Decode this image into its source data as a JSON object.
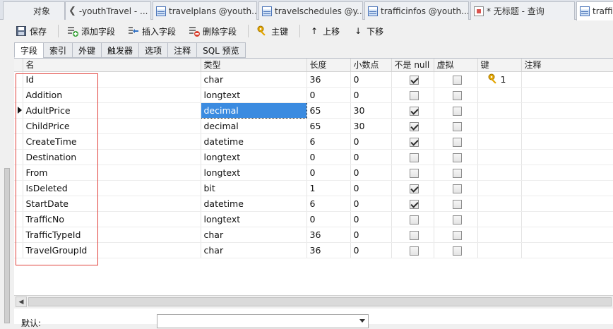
{
  "tabs": [
    {
      "label": "对象",
      "icon": "none"
    },
    {
      "label": "-youthTravel - ...",
      "icon": "back-arrow-icon"
    },
    {
      "label": "travelplans @youth...",
      "icon": "table-icon"
    },
    {
      "label": "travelschedules @y...",
      "icon": "table-icon"
    },
    {
      "label": "trafficinfos @youth...",
      "icon": "table-icon"
    },
    {
      "label": "* 无标题 - 查询",
      "icon": "query-icon"
    },
    {
      "label": "traffic",
      "icon": "table-icon"
    }
  ],
  "toolbar": {
    "save": "保存",
    "add_field": "添加字段",
    "insert_field": "插入字段",
    "delete_field": "删除字段",
    "primary_key": "主键",
    "move_up": "上移",
    "move_down": "下移"
  },
  "subtabs": [
    "字段",
    "索引",
    "外键",
    "触发器",
    "选项",
    "注释",
    "SQL 预览"
  ],
  "columns": {
    "name": "名",
    "type": "类型",
    "length": "长度",
    "decimals": "小数点",
    "not_null": "不是 null",
    "virtual": "虚拟",
    "key": "键",
    "comment": "注释"
  },
  "rows": [
    {
      "name": "Id",
      "type": "char",
      "length": "36",
      "decimals": "0",
      "not_null": true,
      "virtual": false,
      "key": "1"
    },
    {
      "name": "Addition",
      "type": "longtext",
      "length": "0",
      "decimals": "0",
      "not_null": false,
      "virtual": false,
      "key": ""
    },
    {
      "name": "AdultPrice",
      "type": "decimal",
      "length": "65",
      "decimals": "30",
      "not_null": true,
      "virtual": false,
      "key": ""
    },
    {
      "name": "ChildPrice",
      "type": "decimal",
      "length": "65",
      "decimals": "30",
      "not_null": true,
      "virtual": false,
      "key": ""
    },
    {
      "name": "CreateTime",
      "type": "datetime",
      "length": "6",
      "decimals": "0",
      "not_null": true,
      "virtual": false,
      "key": ""
    },
    {
      "name": "Destination",
      "type": "longtext",
      "length": "0",
      "decimals": "0",
      "not_null": false,
      "virtual": false,
      "key": ""
    },
    {
      "name": "From",
      "type": "longtext",
      "length": "0",
      "decimals": "0",
      "not_null": false,
      "virtual": false,
      "key": ""
    },
    {
      "name": "IsDeleted",
      "type": "bit",
      "length": "1",
      "decimals": "0",
      "not_null": true,
      "virtual": false,
      "key": ""
    },
    {
      "name": "StartDate",
      "type": "datetime",
      "length": "6",
      "decimals": "0",
      "not_null": true,
      "virtual": false,
      "key": ""
    },
    {
      "name": "TrafficNo",
      "type": "longtext",
      "length": "0",
      "decimals": "0",
      "not_null": false,
      "virtual": false,
      "key": ""
    },
    {
      "name": "TrafficTypeId",
      "type": "char",
      "length": "36",
      "decimals": "0",
      "not_null": false,
      "virtual": false,
      "key": ""
    },
    {
      "name": "TravelGroupId",
      "type": "char",
      "length": "36",
      "decimals": "0",
      "not_null": false,
      "virtual": false,
      "key": ""
    }
  ],
  "selected_row": 2,
  "bottom": {
    "default_label": "默认:"
  },
  "colors": {
    "selection": "#3b8be0",
    "highlight_box": "#e0403a"
  }
}
